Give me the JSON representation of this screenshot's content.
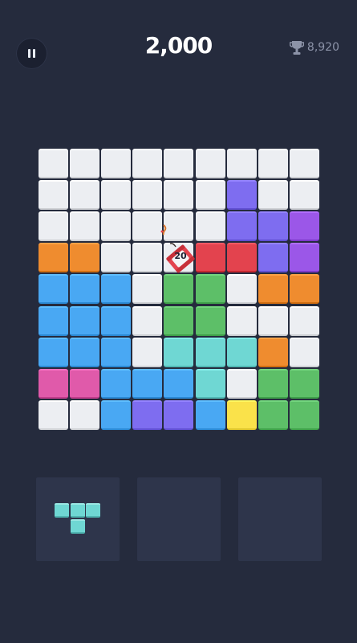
{
  "header": {
    "score": "2,000",
    "best_score": "8,920"
  },
  "colors": {
    "W": "#eceef2",
    "O": "#ef8c2f",
    "B": "#49a8f3",
    "P": "#7e6df0",
    "V": "#9b57e8",
    "R": "#e3434e",
    "G": "#5dbf68",
    "C": "#6fd7d3",
    "M": "#e05aaa",
    "Y": "#fae24a"
  },
  "board": {
    "rows": [
      [
        "W",
        "W",
        "W",
        "W",
        "W",
        "W",
        "W",
        "W",
        "W"
      ],
      [
        "W",
        "W",
        "W",
        "W",
        "W",
        "W",
        "P",
        "W",
        "W"
      ],
      [
        "W",
        "W",
        "W",
        "W",
        "W",
        "W",
        "P",
        "P",
        "V"
      ],
      [
        "O",
        "O",
        "W",
        "W",
        "W",
        "R",
        "R",
        "P",
        "V"
      ],
      [
        "B",
        "B",
        "B",
        "W",
        "G",
        "G",
        "W",
        "O",
        "O"
      ],
      [
        "B",
        "B",
        "B",
        "W",
        "G",
        "G",
        "W",
        "W",
        "W"
      ],
      [
        "B",
        "B",
        "B",
        "W",
        "C",
        "C",
        "C",
        "O",
        "W"
      ],
      [
        "M",
        "M",
        "B",
        "B",
        "B",
        "C",
        "W",
        "G",
        "G"
      ],
      [
        "W",
        "W",
        "B",
        "P",
        "P",
        "B",
        "Y",
        "G",
        "G"
      ]
    ],
    "bomb": {
      "row": 3,
      "col": 4,
      "counter": "20"
    }
  },
  "trays": [
    {
      "piece": "T",
      "color": "C"
    },
    {
      "piece": "",
      "color": ""
    },
    {
      "piece": "",
      "color": ""
    }
  ]
}
